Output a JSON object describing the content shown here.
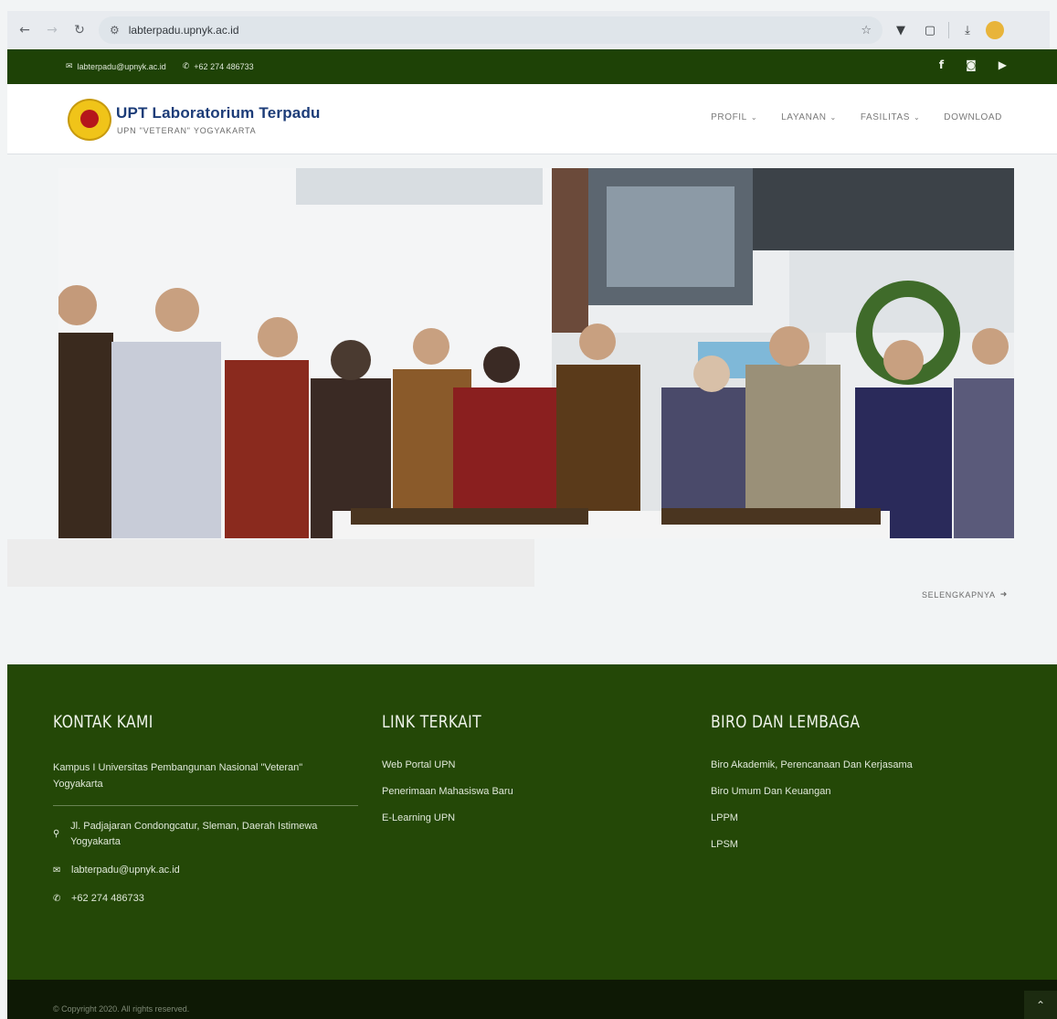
{
  "browser": {
    "url": "labterpadu.upnyk.ac.id",
    "nav": {
      "back": "←",
      "forward": "→",
      "reload": "↻"
    }
  },
  "topbar": {
    "email": "labterpadu@upnyk.ac.id",
    "phone": "+62 274 486733",
    "social_icons": [
      "facebook-icon",
      "instagram-icon",
      "youtube-icon"
    ],
    "bg": "#1e4206"
  },
  "header": {
    "title": "UPT Laboratorium Terpadu",
    "subtitle": "UPN \"VETERAN\" YOGYAKARTA",
    "menu": [
      {
        "label": "PROFIL",
        "dropdown": true
      },
      {
        "label": "LAYANAN",
        "dropdown": true
      },
      {
        "label": "FASILITAS",
        "dropdown": true
      },
      {
        "label": "DOWNLOAD",
        "dropdown": false
      }
    ]
  },
  "main": {
    "more_label": "SELENGKAPNYA"
  },
  "footer": {
    "bg": "#244807",
    "contact": {
      "heading": "KONTAK KAMI",
      "campus": "Kampus I Universitas Pembangunan Nasional \"Veteran\" Yogyakarta",
      "address": "Jl. Padjajaran Condongcatur, Sleman, Daerah Istimewa Yogyakarta",
      "email": "labterpadu@upnyk.ac.id",
      "phone": "+62 274 486733"
    },
    "links": {
      "heading": "LINK TERKAIT",
      "items": [
        "Web Portal UPN",
        "Penerimaan Mahasiswa Baru",
        "E-Learning UPN"
      ]
    },
    "biro": {
      "heading": "BIRO DAN LEMBAGA",
      "items": [
        "Biro Akademik, Perencanaan Dan Kerjasama",
        "Biro Umum Dan Keuangan",
        "LPPM",
        "LPSM"
      ]
    },
    "copyright": "© Copyright 2020. All rights reserved."
  }
}
